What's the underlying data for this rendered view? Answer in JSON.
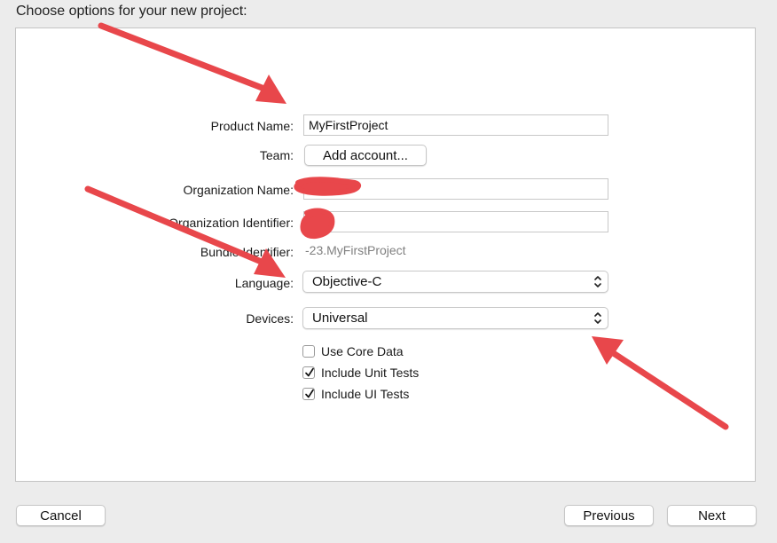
{
  "header": {
    "title": "Choose options for your new project:"
  },
  "form": {
    "product_name": {
      "label": "Product Name:",
      "value": "MyFirstProject"
    },
    "team": {
      "label": "Team:",
      "button": "Add account..."
    },
    "organization_name": {
      "label": "Organization Name:",
      "value": ""
    },
    "organization_identifier": {
      "label": "Organization Identifier:",
      "value": ""
    },
    "bundle_identifier": {
      "label": "Bundle Identifier:",
      "value": "-23.MyFirstProject"
    },
    "language": {
      "label": "Language:",
      "value": "Objective-C"
    },
    "devices": {
      "label": "Devices:",
      "value": "Universal"
    },
    "checkboxes": [
      {
        "label": "Use Core Data",
        "checked": false
      },
      {
        "label": "Include Unit Tests",
        "checked": true
      },
      {
        "label": "Include UI Tests",
        "checked": true
      }
    ]
  },
  "footer": {
    "cancel_label": "Cancel",
    "previous_label": "Previous",
    "next_label": "Next"
  },
  "colors": {
    "annotation_red": "#e8474b",
    "background": "#ececec"
  }
}
